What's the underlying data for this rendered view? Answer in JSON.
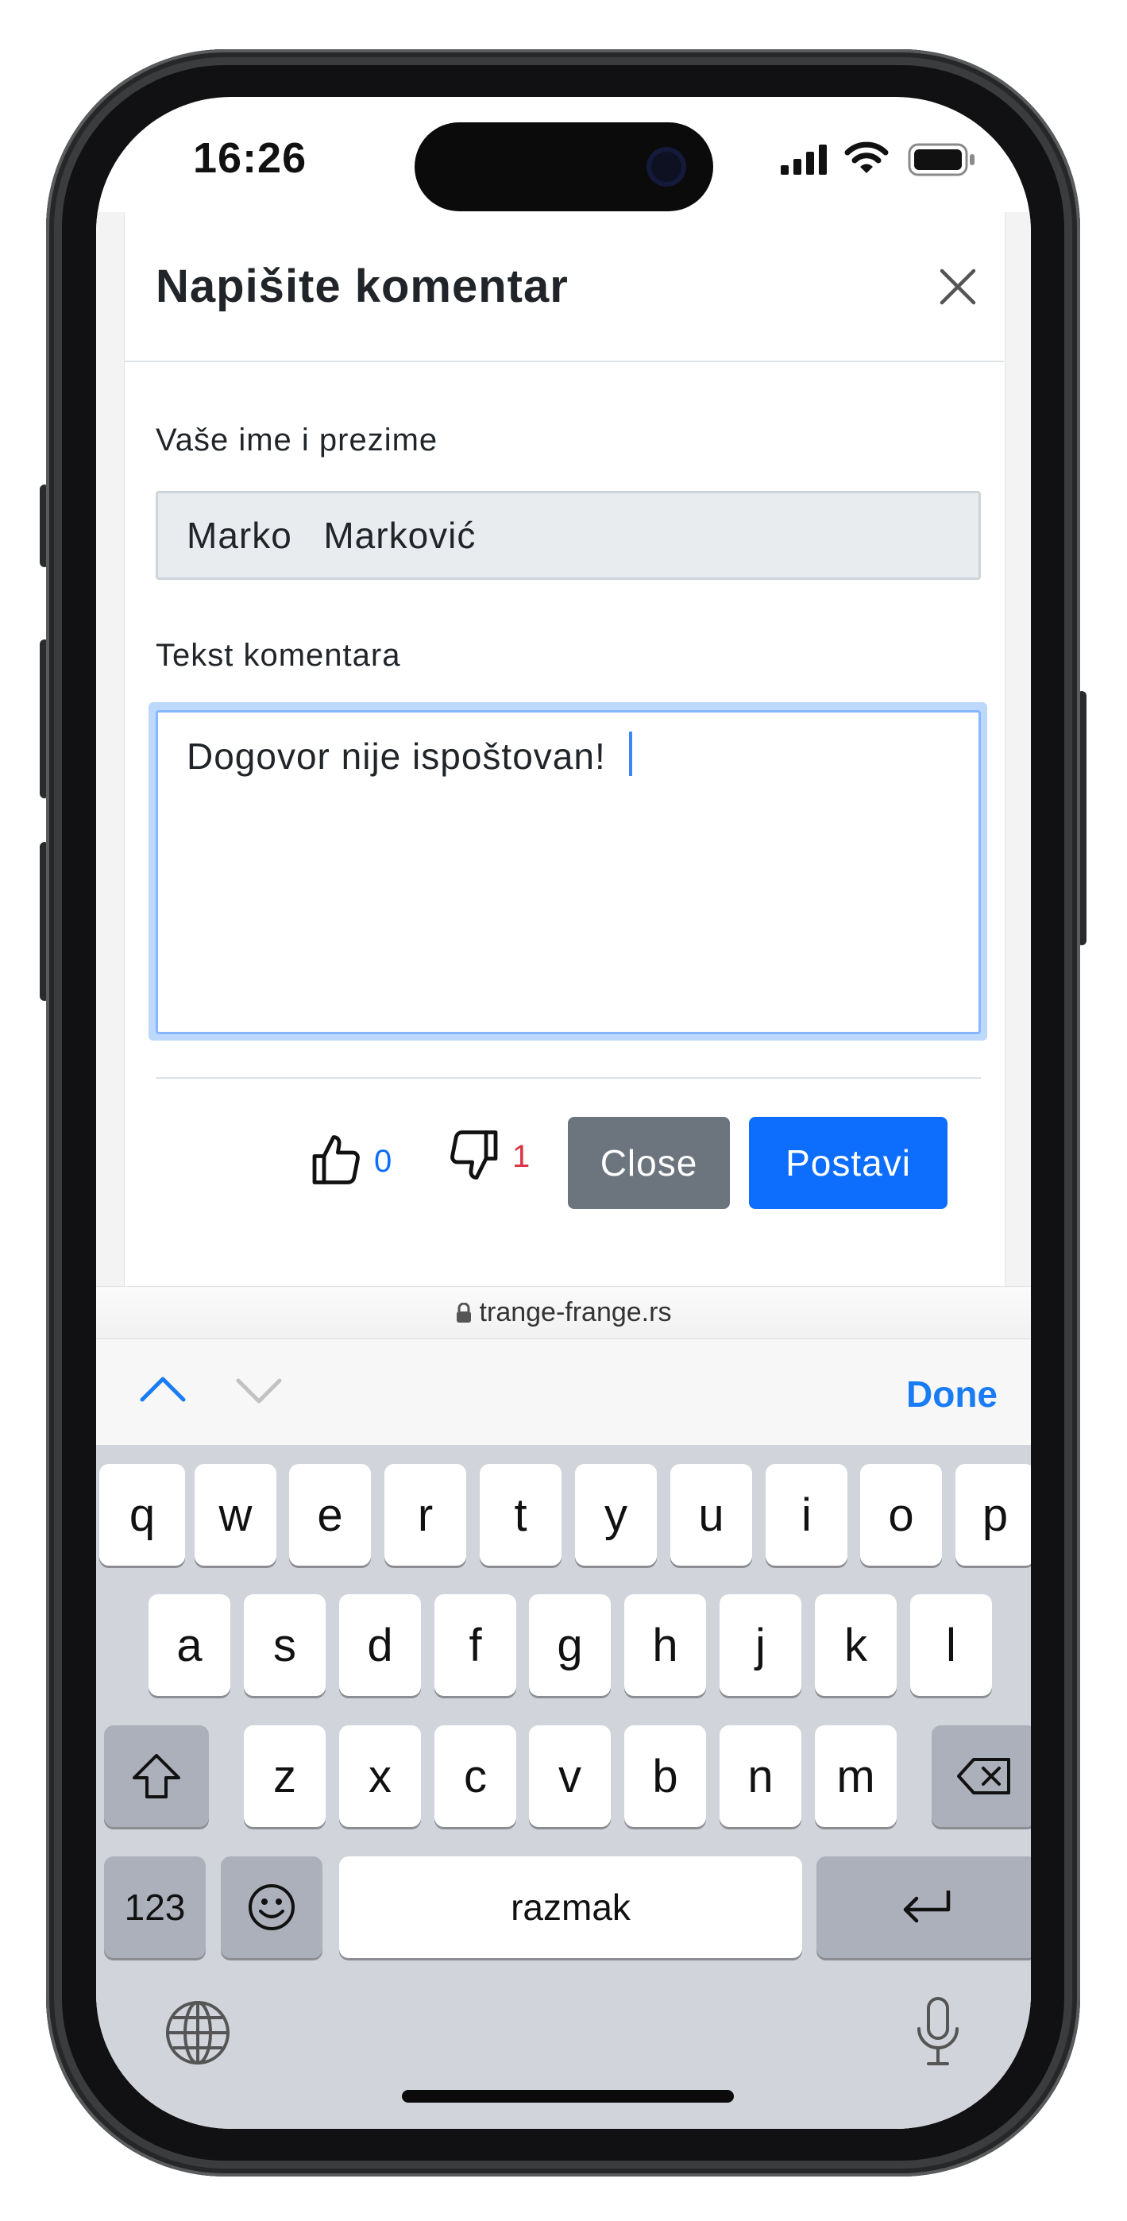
{
  "status_bar": {
    "time": "16:26"
  },
  "modal": {
    "title": "Napišite komentar",
    "name_label": "Vaše ime i prezime",
    "name_value": "Marko  Marković",
    "comment_label": "Tekst komentara",
    "comment_value": "Dogovor nije ispoštovan!",
    "likes": "0",
    "dislikes": "1",
    "close_label": "Close",
    "post_label": "Postavi"
  },
  "browser": {
    "url": "trange-frange.rs"
  },
  "accessory": {
    "done_label": "Done"
  },
  "keyboard": {
    "row1": [
      "q",
      "w",
      "e",
      "r",
      "t",
      "y",
      "u",
      "i",
      "o",
      "p"
    ],
    "row2": [
      "a",
      "s",
      "d",
      "f",
      "g",
      "h",
      "j",
      "k",
      "l"
    ],
    "row3": [
      "z",
      "x",
      "c",
      "v",
      "b",
      "n",
      "m"
    ],
    "numbers_label": "123",
    "space_label": "razmak"
  },
  "colors": {
    "primary": "#0d6efd",
    "secondary": "#6c757d",
    "like_count": "#0d6efd",
    "dislike_count": "#dc3545",
    "ios_accent": "#1a7cf4"
  },
  "icons": [
    "close-icon",
    "thumbs-up-icon",
    "thumbs-down-icon",
    "lock-icon",
    "chevron-up-icon",
    "chevron-down-icon",
    "shift-icon",
    "delete-icon",
    "emoji-icon",
    "return-icon",
    "globe-icon",
    "microphone-icon",
    "signal-icon",
    "wifi-icon",
    "battery-icon"
  ]
}
